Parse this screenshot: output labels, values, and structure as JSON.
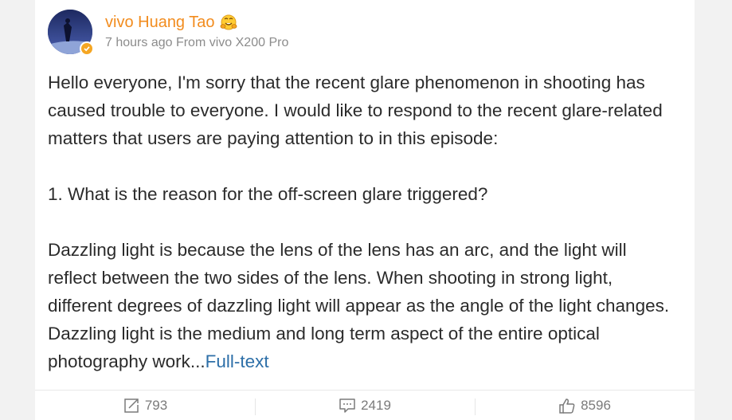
{
  "post": {
    "author": "vivo Huang Tao",
    "meta": "7 hours ago From vivo X200 Pro",
    "paragraphs": {
      "p1": "Hello everyone, I'm sorry that the recent glare phenomenon in shooting has caused trouble to everyone. I would like to respond to the recent glare-related matters that users are paying attention to in this episode:",
      "p2": "1. What is the reason for the off-screen glare triggered?",
      "p3": "Dazzling light is because the lens of the lens has an arc, and the light will reflect between the two sides of the lens. When shooting in strong light, different degrees of dazzling light will appear as the angle of the light changes. Dazzling light is the medium and long term aspect of the entire optical photography work..."
    },
    "full_text_link": "Full-text"
  },
  "actions": {
    "repost": "793",
    "comment": "2419",
    "like": "8596"
  },
  "icons": {
    "verified": "verified-badge-icon",
    "emoji": "hugging-face-emoji-icon",
    "repost": "repost-icon",
    "comment": "comment-icon",
    "like": "thumbs-up-icon"
  },
  "colors": {
    "author_name": "#f28c1e",
    "link": "#2d6fa8",
    "verified_badge": "#f5a623"
  }
}
